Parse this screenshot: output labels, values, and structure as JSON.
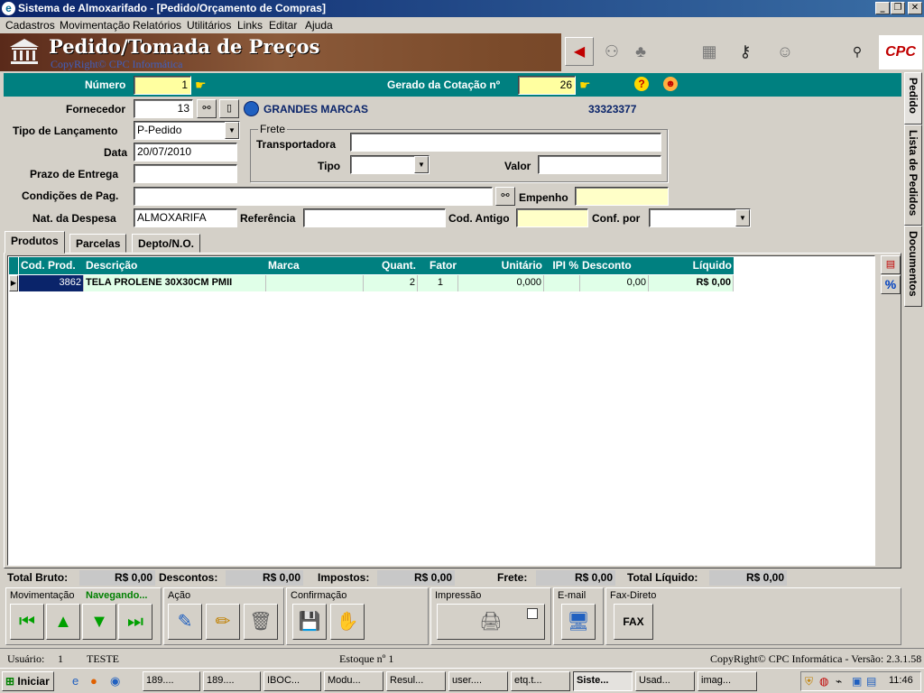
{
  "window": {
    "title": "Sistema de Almoxarifado - [Pedido/Orçamento de Compras]",
    "buttons": [
      "_",
      "❐",
      "✕"
    ]
  },
  "menu": [
    "Cadastros",
    "Movimentação",
    "Relatórios",
    "Utilitários",
    "Links",
    "Editar",
    "Ajuda"
  ],
  "header": {
    "title": "Pedido/Tomada de Preços",
    "subtitle": "CopyRight© CPC Informática",
    "logo": "CPC"
  },
  "form": {
    "numero_label": "Número",
    "numero": "1",
    "gerado_label": "Gerado da Cotação nº",
    "gerado": "26",
    "fornecedor_label": "Fornecedor",
    "fornecedor_codigo": "13",
    "fornecedor_nome": "GRANDES MARCAS",
    "fornecedor_doc": "33323377",
    "tipo_lancamento_label": "Tipo de Lançamento",
    "tipo_lancamento": "P-Pedido",
    "data_label": "Data",
    "data": "20/07/2010",
    "prazo_label": "Prazo de Entrega",
    "prazo": "",
    "condicoes_label": "Condições de Pag.",
    "condicoes": "",
    "empenho_label": "Empenho",
    "empenho": "",
    "nat_despesa_label": "Nat. da Despesa",
    "nat_despesa": "ALMOXARIFA",
    "referencia_label": "Referência",
    "referencia": "",
    "cod_antigo_label": "Cod. Antigo",
    "cod_antigo": "",
    "conf_por_label": "Conf. por",
    "conf_por": "",
    "frete": {
      "legend": "Frete",
      "transportadora_label": "Transportadora",
      "transportadora": "",
      "tipo_label": "Tipo",
      "tipo": "",
      "valor_label": "Valor",
      "valor": ""
    }
  },
  "tabs": [
    "Produtos",
    "Parcelas",
    "Depto/N.O."
  ],
  "grid": {
    "columns": [
      "Cod. Prod.",
      "Descrição",
      "Marca",
      "Quant.",
      "Fator",
      "Unitário",
      "IPI %",
      "Desconto",
      "Líquido"
    ],
    "rows": [
      {
        "cod": "3862",
        "descricao": "TELA PROLENE 30X30CM PMII",
        "marca": "",
        "quant": "2",
        "fator": "1",
        "unitario": "0,000",
        "ipi": "",
        "desconto": "0,00",
        "liquido": "R$ 0,00"
      }
    ]
  },
  "totals": {
    "bruto_label": "Total Bruto:",
    "bruto": "R$ 0,00",
    "descontos_label": "Descontos:",
    "descontos": "R$ 0,00",
    "impostos_label": "Impostos:",
    "impostos": "R$ 0,00",
    "frete_label": "Frete:",
    "frete": "R$ 0,00",
    "liquido_label": "Total Líquido:",
    "liquido": "R$ 0,00"
  },
  "panels": {
    "movimentacao": "Movimentação",
    "status": "Navegando...",
    "acao": "Ação",
    "confirmacao": "Confirmação",
    "impressao": "Impressão",
    "email": "E-mail",
    "fax": "Fax-Direto",
    "fax_button": "FAX"
  },
  "side_tabs": [
    "Pedido",
    "Lista de Pedidos",
    "Documentos"
  ],
  "grid_side_buttons": [
    "%"
  ],
  "statusbar": {
    "usuario_label": "Usuário:",
    "usuario_id": "1",
    "usuario_nome": "TESTE",
    "estoque": "Estoque nº 1",
    "copyright": "CopyRight© CPC Informática - Versão: 2.3.1.58"
  },
  "taskbar": {
    "start": "Iniciar",
    "tasks": [
      "189....",
      "189....",
      "IBOC...",
      "Modu...",
      "Resul...",
      "user....",
      "etq.t...",
      "Siste...",
      "Usad...",
      "imag..."
    ],
    "clock": "11:46"
  }
}
